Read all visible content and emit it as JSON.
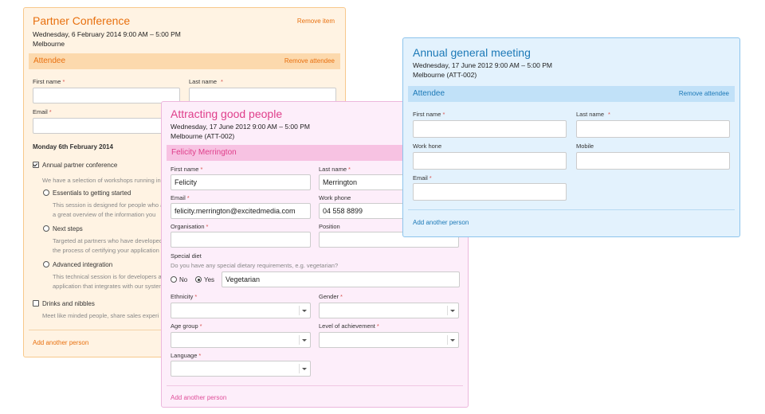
{
  "orange_card": {
    "title": "Partner Conference",
    "remove_item": "Remove item",
    "date": "Wednesday, 6 February 2014 9:00 AM – 5:00 PM",
    "location": "Melbourne",
    "attendee_label": "Attendee",
    "remove_attendee": "Remove attendee",
    "first_name_label": "First name",
    "last_name_label": "Last name",
    "email_label": "Email",
    "day_heading": "Monday 6th February 2014",
    "session_annual": "Annual partner conference",
    "session_annual_desc": "We have a selection of workshops running in",
    "ws1_title": "Essentials to getting started",
    "ws1_desc1": "This session is designed for people who a",
    "ws1_desc2": "a great overview of the information you",
    "ws2_title": "Next steps",
    "ws2_desc1": "Targeted at partners who have developed",
    "ws2_desc2": "the process of certifying your application a",
    "ws3_title": "Advanced integration",
    "ws3_desc1": "This technical session is for developers a",
    "ws3_desc2": "application that integrates with our system",
    "drinks_title": "Drinks and nibbles",
    "drinks_desc": "Meet like minded people, share sales experi",
    "add_person": "Add another person"
  },
  "pink_card": {
    "title": "Attracting good people",
    "date": "Wednesday, 17 June 2012 9:00 AM – 5:00 PM",
    "location": "Melbourne (ATT-002)",
    "attendee_name": "Felicity Merrington",
    "first_name_label": "First name",
    "first_name_value": "Felicity",
    "last_name_label": "Last name",
    "last_name_value": "Merrington",
    "email_label": "Email",
    "email_value": "felicity.merrington@excitedmedia.com",
    "work_phone_label": "Work phone",
    "work_phone_value": "04 558 8899",
    "organisation_label": "Organisation",
    "position_label": "Position",
    "special_diet_label": "Special diet",
    "special_diet_question": "Do you have any special dietary requirements, e.g. vegetarian?",
    "no_label": "No",
    "yes_label": "Yes",
    "diet_value": "Vegetarian",
    "ethnicity_label": "Ethnicity",
    "gender_label": "Gender",
    "age_group_label": "Age group",
    "achievement_label": "Level of achievement",
    "language_label": "Language",
    "add_person": "Add another person"
  },
  "blue_card": {
    "title": "Annual general meeting",
    "date": "Wednesday, 17 June 2012 9:00 AM – 5:00 PM",
    "location": "Melbourne (ATT-002)",
    "attendee_label": "Attendee",
    "remove_attendee": "Remove attendee",
    "first_name_label": "First name",
    "last_name_label": "Last name",
    "work_phone_label": "Work hone",
    "mobile_label": "Mobile",
    "email_label": "Email",
    "add_person": "Add another person"
  },
  "required_marker": "*",
  "colors": {
    "orange_accent": "#e8700f",
    "pink_accent": "#df3e8a",
    "blue_accent": "#1c79b7"
  }
}
